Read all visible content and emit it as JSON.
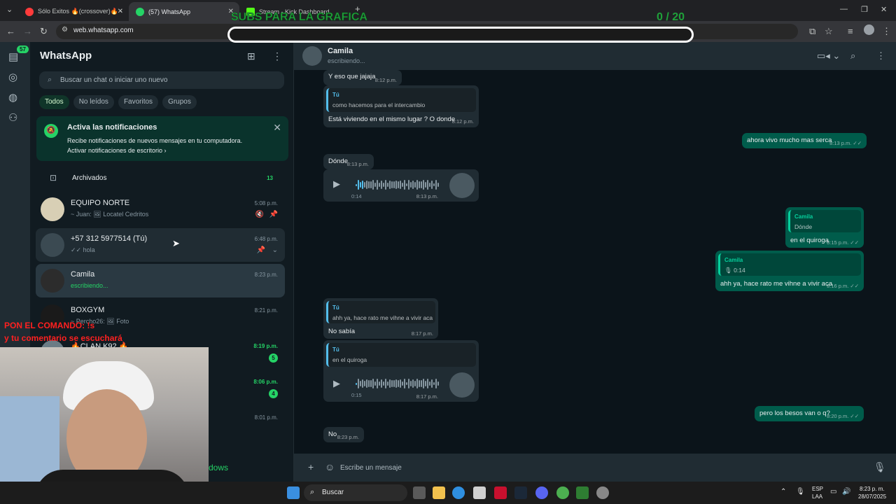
{
  "browser": {
    "tabs": [
      {
        "label": "Sólo Exitos 🔥(crossover)🔥 - ",
        "favicon_color": "#ff3b3b"
      },
      {
        "label": "(57) WhatsApp",
        "favicon_color": "#25d366"
      },
      {
        "label": "Stream - Kick Dashboard",
        "favicon_color": "#53fc18"
      }
    ],
    "new_tab": "+",
    "url": "web.whatsapp.com"
  },
  "overlay": {
    "title": "SUBS PARA LA GRAFICA",
    "count": "0  / 20",
    "command_line1": "PON EL COMANDO: !s",
    "command_line2": "y tu comentario se escuchará",
    "windows_watermark": "dows"
  },
  "rail": {
    "badge": "57"
  },
  "sidebar": {
    "app_name": "WhatsApp",
    "search_placeholder": "Buscar un chat o iniciar uno nuevo",
    "filters": [
      "Todos",
      "No leídos",
      "Favoritos",
      "Grupos"
    ],
    "notification": {
      "title": "Activa las notificaciones",
      "desc": "Recibe notificaciones de nuevos mensajes en tu computadora.",
      "link": "Activar notificaciones de escritorio ›"
    },
    "archived": {
      "label": "Archivados",
      "count": "13"
    },
    "chats": [
      {
        "name": "EQUIPO NORTE",
        "preview": "~ Juan: 🖼 Locatel Cedritos",
        "time": "5:08 p.m."
      },
      {
        "name": "+57 312 5977514 (Tú)",
        "preview": "✓✓ hola",
        "time": "6:48 p.m."
      },
      {
        "name": "Camila",
        "preview": "escribiendo...",
        "time": "8:23 p.m."
      },
      {
        "name": "BOXGYM",
        "preview": "~ Percho26: 🖼 Foto",
        "time": "8:21 p.m."
      },
      {
        "name": "🔥CLAN K92 🔥",
        "preview": "",
        "time": "8:19 p.m.",
        "unread": "5"
      },
      {
        "name": "",
        "preview": "",
        "time": "8:06 p.m.",
        "unread": "4"
      },
      {
        "name": "",
        "preview": "",
        "time": "8:01 p.m."
      }
    ]
  },
  "chat": {
    "name": "Camila",
    "status": "escribiendo...",
    "messages": {
      "m1": {
        "text": "Y eso que jajaja",
        "time": "8:12 p.m."
      },
      "m2": {
        "quote_author": "Tú",
        "quote_text": "como hacemos para el intercambio",
        "text": "Está viviendo en el mismo lugar ? O donde",
        "time": "8:12 p.m."
      },
      "m3": {
        "text": "ahora vivo mucho mas serca",
        "time": "8:13 p.m. ✓✓"
      },
      "m4": {
        "text": "Dónde",
        "time": "8:13 p.m."
      },
      "m5": {
        "duration": "0:14",
        "time": "8:13 p.m.",
        "progress": 0.08
      },
      "m6": {
        "quote_author": "Camila",
        "quote_text": "Dónde",
        "text": "en el quiroga",
        "time": "8:15 p.m. ✓✓"
      },
      "m7": {
        "quote_author": "Camila",
        "quote_text": "🎙 0:14",
        "text": "ahh ya, hace rato me vihne a vivir aca",
        "time": "8:16 p.m. ✓✓"
      },
      "m8": {
        "quote_author": "Tú",
        "quote_text": "ahh ya, hace rato me vihne a vivir aca",
        "text": "No sabía",
        "time": "8:17 p.m."
      },
      "m9": {
        "quote_author": "Tú",
        "quote_text": "en el quiroga",
        "duration": "0:15",
        "time": "8:17 p.m.",
        "progress": 0.02
      },
      "m10": {
        "text": "pero los besos van o q?",
        "time": "8:20 p.m. ✓✓"
      },
      "m11": {
        "text": "No",
        "time": "8:23 p.m."
      }
    },
    "composer_placeholder": "Escribe un mensaje"
  },
  "taskbar": {
    "search_label": "Buscar",
    "lang_line1": "ESP",
    "lang_line2": "LAA",
    "time": "8:23 p. m.",
    "date": "28/07/2025"
  },
  "colors": {
    "accent": "#25d366",
    "outgoing": "#005c4b",
    "incoming": "#202c33"
  }
}
